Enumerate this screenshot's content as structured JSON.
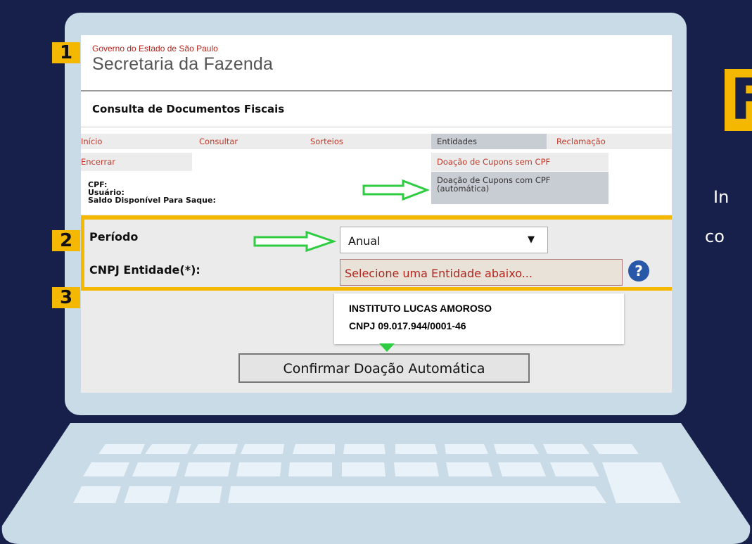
{
  "header": {
    "government": "Governo do Estado de São Paulo",
    "secretariat": "Secretaria da Fazenda"
  },
  "page_title": "Consulta de Documentos Fiscais",
  "menu": {
    "items": [
      "Início",
      "Consultar",
      "Sorteios",
      "Entidades",
      "Reclamação"
    ],
    "logout": "Encerrar",
    "submenu": [
      "Doação de Cupons sem CPF",
      "Doação de Cupons com CPF (automática)"
    ]
  },
  "user_info": {
    "cpf_label": "CPF:",
    "user_label": "Usuário:",
    "balance_label": "Saldo Disponível Para Saque:"
  },
  "form": {
    "period_label": "Período",
    "period_value": "Anual",
    "entity_label": "CNPJ Entidade(*):",
    "entity_placeholder": "Selecione uma Entidade abaixo...",
    "help": "?"
  },
  "callout": {
    "line1": "INSTITUTO LUCAS AMOROSO",
    "line2": "CNPJ 09.017.944/0001-46"
  },
  "confirm_button": "Confirmar Doação Automática",
  "steps": [
    "1",
    "2",
    "3"
  ],
  "right_text": {
    "big": "F",
    "line1": "In",
    "line2": "co"
  },
  "colors": {
    "background": "#17204a",
    "accent": "#f5b800",
    "arrow": "#2ecc40"
  }
}
